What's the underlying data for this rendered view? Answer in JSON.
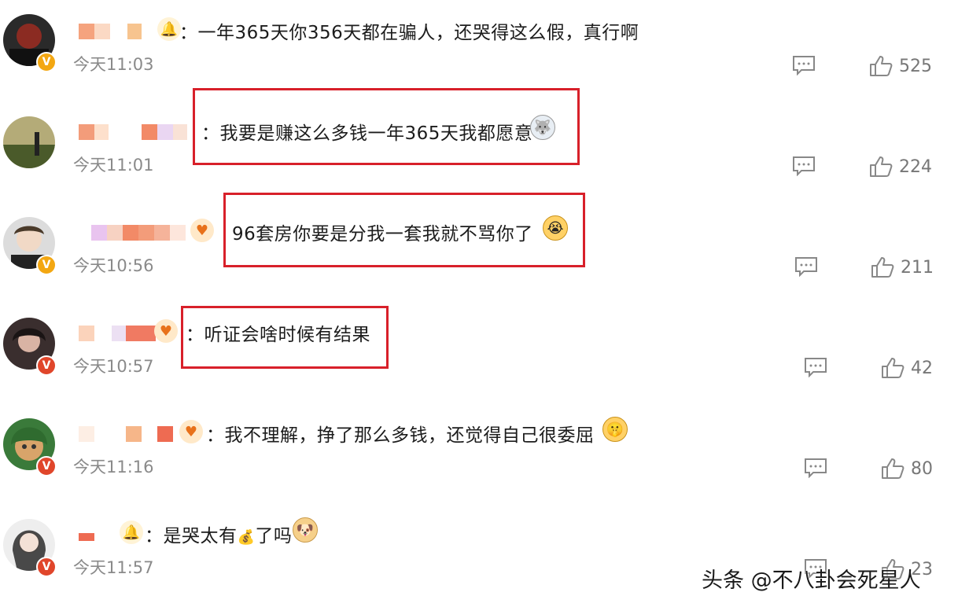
{
  "comments": [
    {
      "text": "：一年365天你356天都在骗人，还哭得这么假，真行啊",
      "time": "今天11:03",
      "likes": "525"
    },
    {
      "text": "：我要是赚这么多钱一年365天我都愿意",
      "time": "今天11:01",
      "likes": "224"
    },
    {
      "text": "96套房你要是分我一套我就不骂你了",
      "time": "今天10:56",
      "likes": "211"
    },
    {
      "text": "：听证会啥时候有结果",
      "time": "今天10:57",
      "likes": "42"
    },
    {
      "text": "：我不理解，挣了那么多钱，还觉得自己很委屈",
      "time": "今天11:16",
      "likes": "80"
    },
    {
      "text": "：是哭太有",
      "text_end": "了吗",
      "time": "今天11:57",
      "likes": "23"
    }
  ],
  "watermark": "头条 @不八卦会死星人",
  "colors": {
    "highlight_box": "#d8202a",
    "verified_gold": "#f3a712",
    "verified_red": "#e0462b"
  },
  "icons": [
    "comment-icon",
    "thumbs-up-icon",
    "verified-badge-icon",
    "emoji-icon",
    "money-bag-icon"
  ]
}
